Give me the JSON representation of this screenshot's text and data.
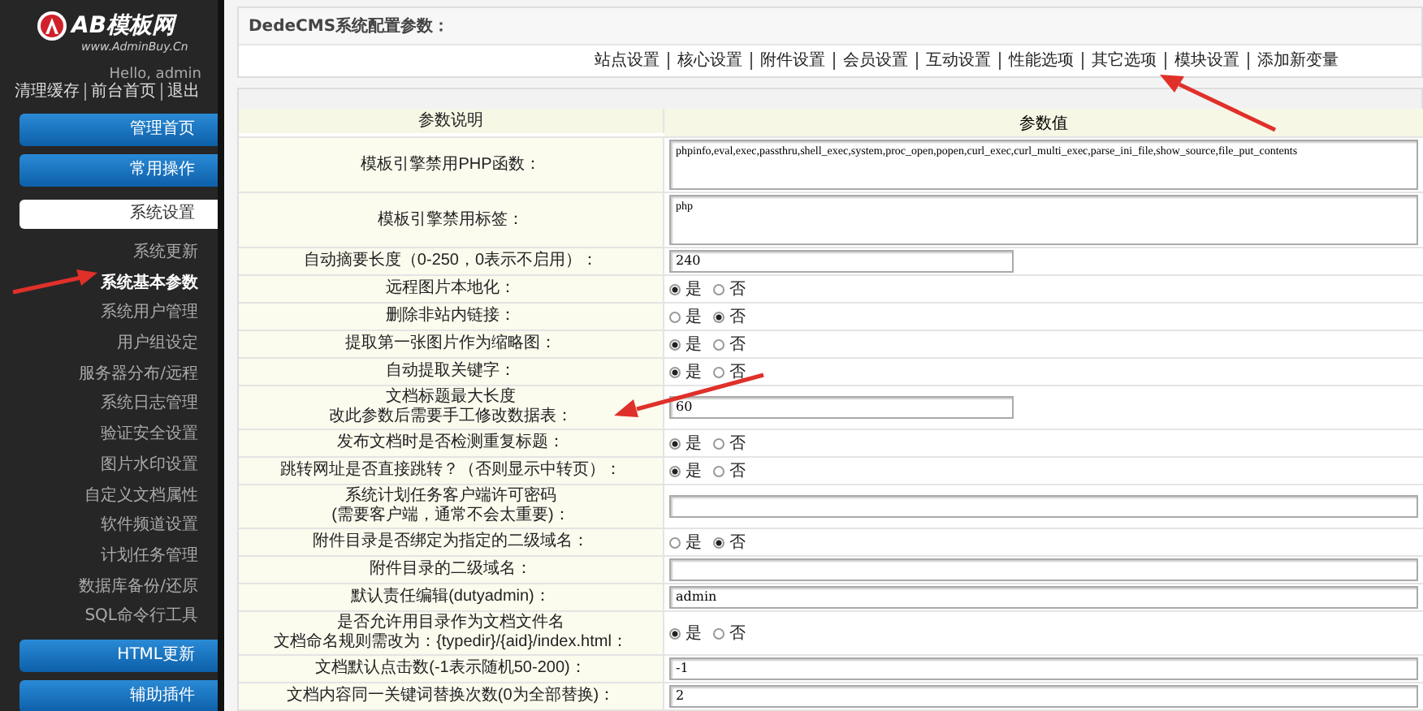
{
  "sidebar": {
    "logo": "AB模板网",
    "logo_subtitle": "www.AdminBuy.Cn",
    "greeting": "Hello, admin",
    "user_links": [
      "清理缓存",
      "前台首页",
      "退出"
    ],
    "menu": [
      {
        "label": "管理首页",
        "kind": "button"
      },
      {
        "label": "常用操作",
        "kind": "button"
      },
      {
        "label": "系统设置",
        "kind": "section",
        "expanded": true,
        "children": [
          {
            "label": "系统更新",
            "selected": false
          },
          {
            "label": "系统基本参数",
            "selected": true
          },
          {
            "label": "系统用户管理",
            "selected": false
          },
          {
            "label": "用户组设定",
            "selected": false
          },
          {
            "label": "服务器分布/远程",
            "selected": false
          },
          {
            "label": "系统日志管理",
            "selected": false
          },
          {
            "label": "验证安全设置",
            "selected": false
          },
          {
            "label": "图片水印设置",
            "selected": false
          },
          {
            "label": "自定义文档属性",
            "selected": false
          },
          {
            "label": "软件频道设置",
            "selected": false
          },
          {
            "label": "计划任务管理",
            "selected": false
          },
          {
            "label": "数据库备份/还原",
            "selected": false
          },
          {
            "label": "SQL命令行工具",
            "selected": false
          }
        ]
      },
      {
        "label": "HTML更新",
        "kind": "button"
      },
      {
        "label": "辅助插件",
        "kind": "button"
      }
    ]
  },
  "panel": {
    "title": "DedeCMS系统配置参数：",
    "tabs": [
      "站点设置",
      "核心设置",
      "附件设置",
      "会员设置",
      "互动设置",
      "性能选项",
      "其它选项",
      "模块设置",
      "添加新变量"
    ]
  },
  "table": {
    "columns": [
      "参数说明",
      "参数值"
    ],
    "rows": [
      {
        "label": "模板引擎禁用PHP函数：",
        "kind": "textarea",
        "value": "phpinfo,eval,exec,passthru,shell_exec,system,proc_open,popen,curl_exec,curl_multi_exec,parse_ini_file,show_source,file_put_contents"
      },
      {
        "label": "模板引擎禁用标签：",
        "kind": "textarea",
        "value": "php"
      },
      {
        "label": "自动摘要长度（0-250，0表示不启用）：",
        "kind": "short_text",
        "value": "240"
      },
      {
        "label": "远程图片本地化：",
        "kind": "radio",
        "options": [
          {
            "label": "是",
            "selected": true
          },
          {
            "label": "否",
            "selected": false
          }
        ]
      },
      {
        "label": "删除非站内链接：",
        "kind": "radio",
        "options": [
          {
            "label": "是",
            "selected": false
          },
          {
            "label": "否",
            "selected": true
          }
        ]
      },
      {
        "label": "提取第一张图片作为缩略图：",
        "kind": "radio",
        "options": [
          {
            "label": "是",
            "selected": true
          },
          {
            "label": "否",
            "selected": false
          }
        ]
      },
      {
        "label": "自动提取关键字：",
        "kind": "radio",
        "options": [
          {
            "label": "是",
            "selected": true
          },
          {
            "label": "否",
            "selected": false
          }
        ]
      },
      {
        "label_lines": [
          "文档标题最大长度",
          "改此参数后需要手工修改数据表："
        ],
        "kind": "short_text",
        "value": "60"
      },
      {
        "label": "发布文档时是否检测重复标题：",
        "kind": "radio",
        "options": [
          {
            "label": "是",
            "selected": true
          },
          {
            "label": "否",
            "selected": false
          }
        ]
      },
      {
        "label": "跳转网址是否直接跳转？（否则显示中转页）：",
        "kind": "radio",
        "options": [
          {
            "label": "是",
            "selected": true
          },
          {
            "label": "否",
            "selected": false
          }
        ]
      },
      {
        "label_lines": [
          "系统计划任务客户端许可密码",
          "(需要客户端，通常不会太重要)："
        ],
        "kind": "long_text"
      },
      {
        "label": "附件目录是否绑定为指定的二级域名：",
        "kind": "radio",
        "options": [
          {
            "label": "是",
            "selected": false
          },
          {
            "label": "否",
            "selected": true
          }
        ]
      },
      {
        "label": "附件目录的二级域名：",
        "kind": "long_text"
      },
      {
        "label": "默认责任编辑(dutyadmin)：",
        "kind": "long_text",
        "value": "admin"
      },
      {
        "label_lines": [
          "是否允许用目录作为文档文件名",
          "文档命名规则需改为：{typedir}/{aid}/index.html："
        ],
        "kind": "radio",
        "options": [
          {
            "label": "是",
            "selected": true
          },
          {
            "label": "否",
            "selected": false
          }
        ]
      },
      {
        "label": "文档默认点击数(-1表示随机50-200)：",
        "kind": "long_text",
        "value": "-1"
      },
      {
        "label": "文档内容同一关键词替换次数(0为全部替换)：",
        "kind": "long_text",
        "value": "2"
      }
    ]
  }
}
